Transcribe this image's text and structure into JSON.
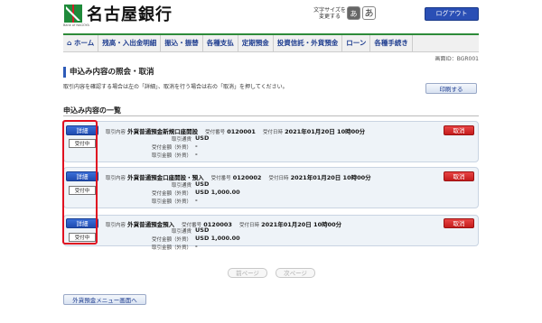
{
  "header": {
    "bank_name": "名古屋銀行",
    "bank_name_en": "Bank of NAGOYA",
    "font_size_label": "文字サイズを変更する",
    "font_small": "あ",
    "font_large": "あ",
    "logout": "ログアウト"
  },
  "nav": {
    "items": [
      "ホーム",
      "残高・入出金明細",
      "振込・振替",
      "各種支払",
      "定期預金",
      "投資信託・外貨預金",
      "ローン",
      "各種手続き"
    ]
  },
  "screen_id": "画面ID：BGR001",
  "page_title": "申込み内容の照会・取消",
  "description": "取引内容を確認する場合は左の「詳細」、取消を行う場合は右の「取消」を押してください。",
  "print_button": "印刷する",
  "list_title": "申込み内容の一覧",
  "labels": {
    "detail": "詳細",
    "cancel": "取消",
    "txn_content": "取引内容",
    "receipt_no": "受付番号",
    "receipt_date": "受付日時",
    "currency": "取引通貨",
    "amount_fx": "受付金額（外貨）",
    "txn_amount_fx": "取引金額（外貨）"
  },
  "applications": [
    {
      "type": "外貨普通預金新規口座開設",
      "receipt_no": "0120001",
      "datetime": "2021年01月20日 10時00分",
      "currency": "USD",
      "amount": "-",
      "txn_amount": "-",
      "status": "受付中"
    },
    {
      "type": "外貨普通預金口座開設・預入",
      "receipt_no": "0120002",
      "datetime": "2021年01月20日 10時00分",
      "currency": "USD",
      "amount": "USD 1,000.00",
      "txn_amount": "-",
      "status": "受付中"
    },
    {
      "type": "外貨普通預金預入",
      "receipt_no": "0120003",
      "datetime": "2021年01月20日 10時00分",
      "currency": "USD",
      "amount": "USD 1,000.00",
      "txn_amount": "-",
      "status": "受付中"
    }
  ],
  "pagination": {
    "prev": "前ページ",
    "next": "次ページ"
  },
  "back_button": "外貨預金メニュー画面へ"
}
